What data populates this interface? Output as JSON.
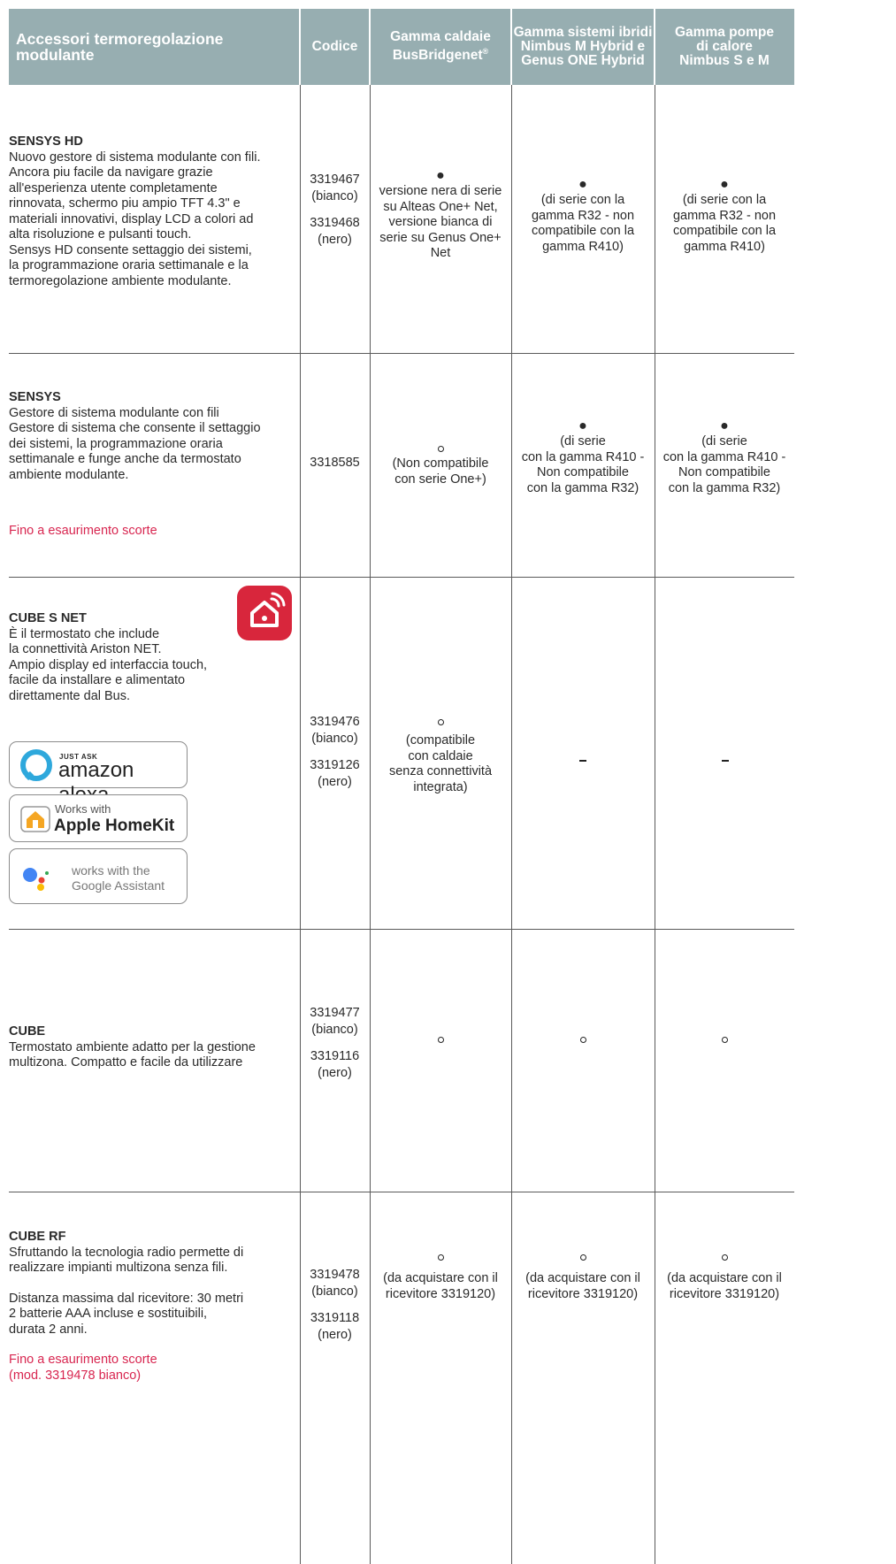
{
  "headers": {
    "product": "Accessori termoregolazione modulante",
    "code": "Codice",
    "col1": "Gamma caldaie BusBridgenet",
    "col1_sup": "®",
    "col2": "Gamma sistemi ibridi Nimbus M Hybrid e Genus ONE Hybrid",
    "col3": "Gamma pompe di calore Nimbus S e M"
  },
  "symbols": {
    "full_dot": "●",
    "dash": "–"
  },
  "colors": {
    "header_bg": "#97aeb1",
    "accent_red": "#d82650",
    "app_icon": "#d8263c"
  },
  "rows": [
    {
      "name": "SENSYS HD",
      "desc": [
        "Nuovo gestore di sistema modulante con fili.",
        "Ancora piu facile da navigare grazie",
        "all'esperienza utente completamente",
        "rinnovata, schermo piu ampio TFT 4.3\" e",
        "materiali innovativi, display LCD a colori ad",
        "alta risoluzione e pulsanti touch.",
        "Sensys HD consente settaggio dei sistemi,",
        "la programmazione oraria settimanale e la",
        "termoregolazione ambiente modulante."
      ],
      "codes": [
        "3319467",
        "(bianco)",
        "3319468",
        "(nero)"
      ],
      "col1": [
        "versione nera di serie",
        "su Alteas One+ Net,",
        "versione bianca di",
        "serie su Genus One+",
        "Net"
      ],
      "col2": [
        "(di serie con la",
        "gamma R32 -  non",
        "compatibile con la",
        "gamma R410)"
      ],
      "col3": [
        "(di serie con la",
        "gamma R32 - non",
        "compatibile con la",
        "gamma R410)"
      ]
    },
    {
      "name": "SENSYS",
      "subtitle": "Gestore di sistema modulante con fili",
      "desc": [
        "Gestore di sistema che consente il settaggio",
        "dei sistemi, la programmazione oraria",
        "settimanale e funge anche da termostato",
        "ambiente modulante."
      ],
      "note": "Fino a esaurimento scorte",
      "code": "3318585",
      "col1": [
        "(Non compatibile",
        "con serie One+)"
      ],
      "col2": [
        "(di serie",
        "con la gamma R410 -",
        "Non compatibile",
        "con la gamma R32)"
      ],
      "col3": [
        "(di serie",
        "con la gamma R410 -",
        "Non compatibile",
        "con la gamma R32)"
      ]
    },
    {
      "name": "CUBE S NET",
      "desc": [
        "È il termostato che include",
        "la connettività Ariston NET.",
        "Ampio display ed interfaccia touch,",
        "facile da installare e alimentato",
        "direttamente dal Bus."
      ],
      "codes": [
        "3319476",
        "(bianco)",
        "3319126",
        "(nero)"
      ],
      "col1": [
        "(compatibile",
        "con caldaie",
        "senza connettività",
        "integrata)"
      ],
      "badges": {
        "alexa_small": "JUST ASK",
        "alexa_big": "amazon alexa",
        "homekit_small": "Works with",
        "homekit_big": "Apple HomeKit",
        "google_small": "works with the",
        "google_big": "Google Assistant"
      }
    },
    {
      "name": "CUBE",
      "desc": [
        "Termostato ambiente adatto per la gestione",
        "multizona. Compatto e facile da utilizzare"
      ],
      "codes": [
        "3319477",
        "(bianco)",
        "3319116",
        "(nero)"
      ]
    },
    {
      "name": "CUBE RF",
      "desc": [
        "Sfruttando la tecnologia radio permette di",
        "realizzare impianti multizona senza fili."
      ],
      "desc2": [
        "Distanza massima dal ricevitore: 30 metri",
        "2 batterie AAA incluse e sostituibili,",
        "durata 2 anni."
      ],
      "note": [
        "Fino a esaurimento scorte",
        "(mod. 3319478 bianco)"
      ],
      "codes": [
        "3319478",
        "(bianco)",
        "3319118",
        "(nero)"
      ],
      "col1": [
        "(da acquistare con il",
        "ricevitore 3319120)"
      ],
      "col2": [
        "(da acquistare con il",
        "ricevitore 3319120)"
      ],
      "col3": [
        "(da acquistare con il",
        "ricevitore 3319120)"
      ]
    }
  ]
}
